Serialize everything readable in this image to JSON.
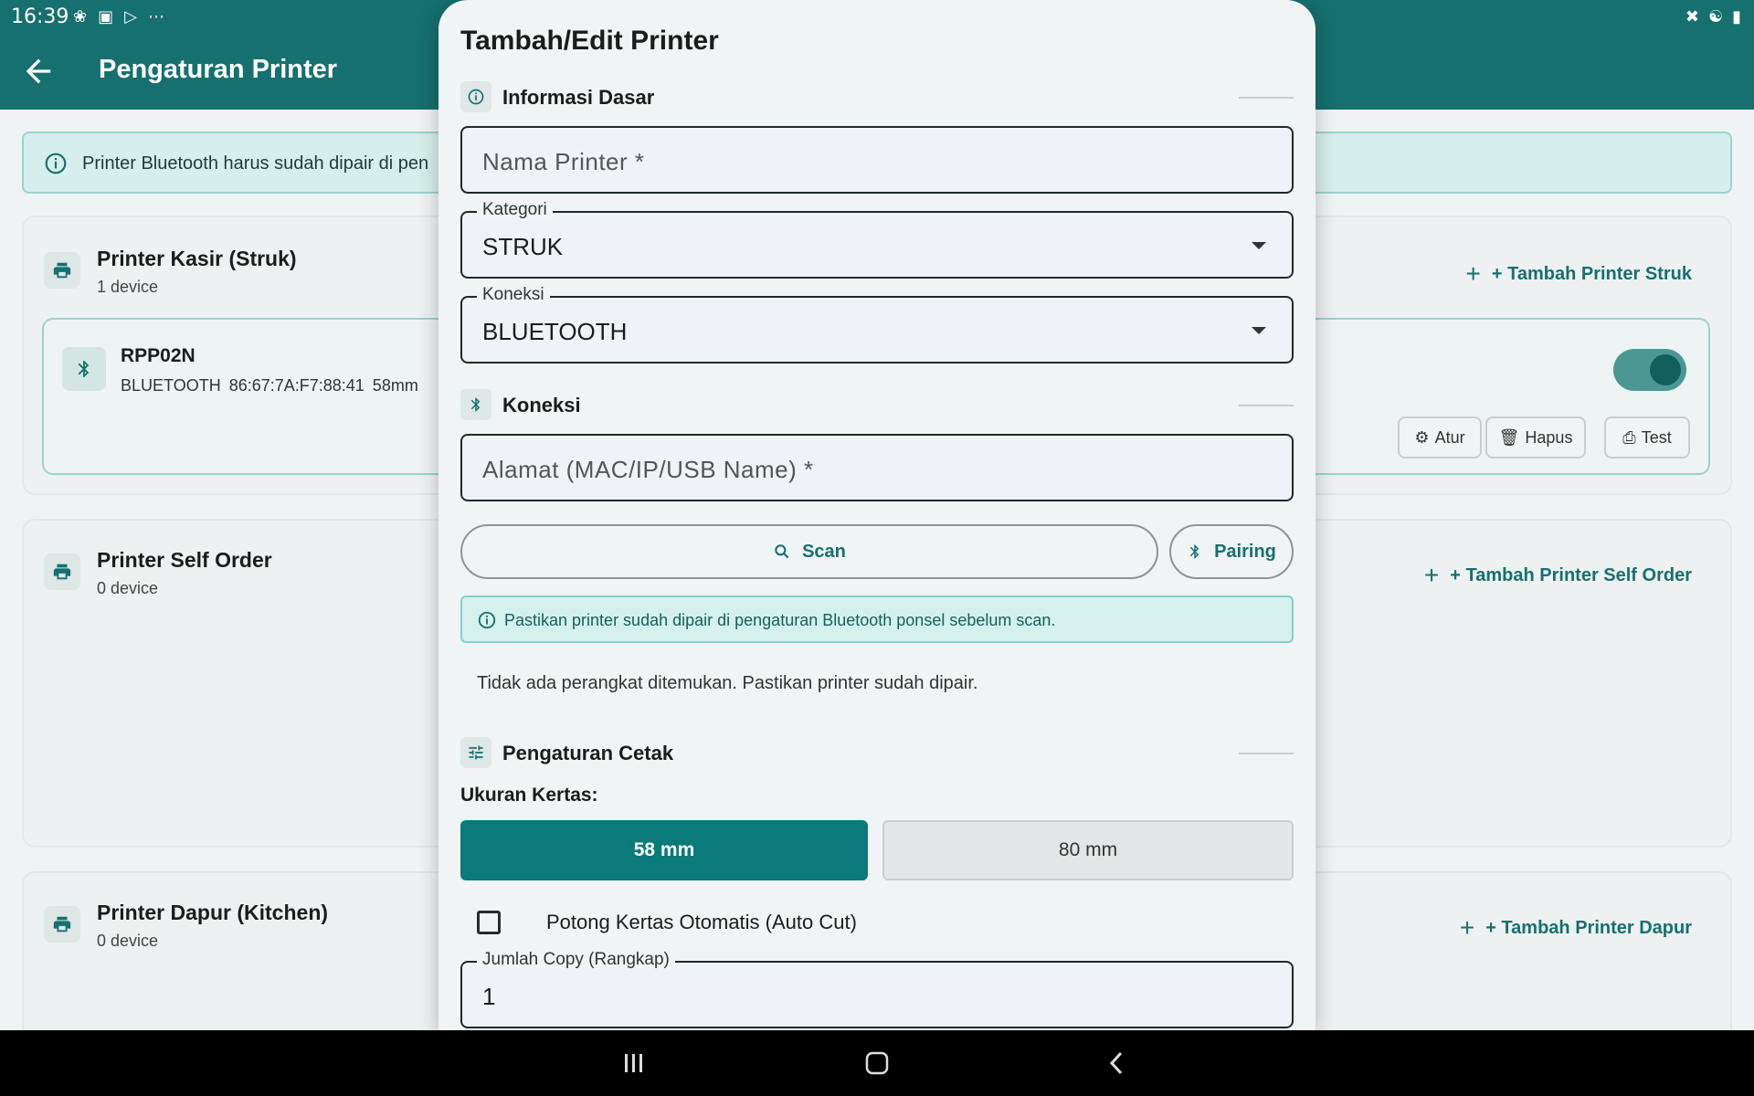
{
  "status_bar": {
    "time": "16:39"
  },
  "app_bar": {
    "title": "Pengaturan Printer"
  },
  "banner": {
    "text": "Printer Bluetooth harus sudah dipair di pen"
  },
  "sections": [
    {
      "title": "Printer Kasir (Struk)",
      "count": "1 device",
      "add_label": "+ Tambah Printer Struk"
    },
    {
      "title": "Printer Self Order",
      "count": "0 device",
      "add_label": "+ Tambah Printer Self Order"
    },
    {
      "title": "Printer Dapur (Kitchen)",
      "count": "0 device",
      "add_label": "+ Tambah Printer Dapur"
    }
  ],
  "device": {
    "name": "RPP02N",
    "meta": "BLUETOOTH  86:67:7A:F7:88:41  58mm",
    "enabled": true,
    "actions": {
      "configure": "Atur",
      "delete": "Hapus",
      "test": "Test"
    }
  },
  "dialog": {
    "title": "Tambah/Edit Printer",
    "basic_info_title": "Informasi Dasar",
    "name_placeholder": "Nama Printer *",
    "category": {
      "label": "Kategori",
      "value": "STRUK"
    },
    "connection_type": {
      "label": "Koneksi",
      "value": "BLUETOOTH"
    },
    "connection_title": "Koneksi",
    "address_placeholder": "Alamat (MAC/IP/USB Name) *",
    "scan_label": "Scan",
    "pairing_label": "Pairing",
    "hint": "Pastikan printer sudah dipair di pengaturan Bluetooth ponsel sebelum scan.",
    "empty_text": "Tidak ada perangkat ditemukan. Pastikan printer sudah dipair.",
    "print_settings_title": "Pengaturan Cetak",
    "paper_size_label": "Ukuran Kertas:",
    "paper_options": [
      "58 mm",
      "80 mm"
    ],
    "paper_selected": "58 mm",
    "auto_cut": {
      "label": "Potong Kertas Otomatis (Auto Cut)",
      "checked": false
    },
    "copies": {
      "label": "Jumlah Copy (Rangkap)",
      "value": "1"
    }
  },
  "colors": {
    "primary": "#15706f",
    "accent": "#0b7a7a",
    "hint_bg": "#d5f1ee"
  }
}
